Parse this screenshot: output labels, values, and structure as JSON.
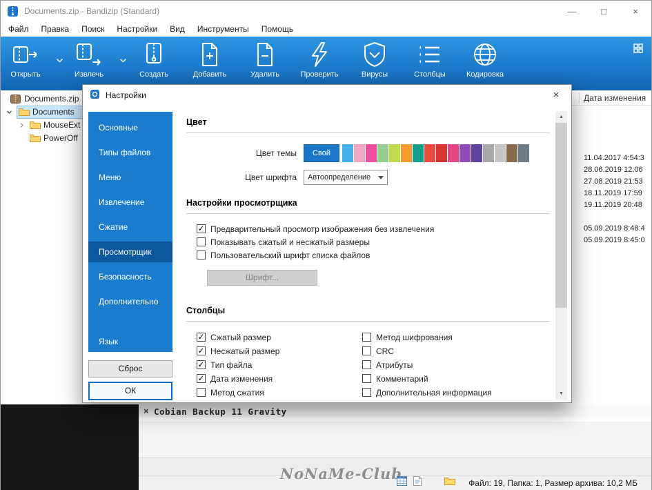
{
  "window": {
    "title": "Documents.zip - Bandizip (Standard)",
    "minimize": "—",
    "maximize": "□",
    "close": "×"
  },
  "menubar": {
    "items": [
      "Файл",
      "Правка",
      "Поиск",
      "Настройки",
      "Вид",
      "Инструменты",
      "Помощь"
    ]
  },
  "toolbar": {
    "buttons": [
      {
        "label": "Открыть",
        "icon": "open-archive-icon",
        "dropdown": true
      },
      {
        "label": "Извлечь",
        "icon": "extract-icon",
        "dropdown": true
      },
      {
        "label": "Создать",
        "icon": "new-archive-icon",
        "dropdown": false
      },
      {
        "label": "Добавить",
        "icon": "add-files-icon",
        "dropdown": false
      },
      {
        "label": "Удалить",
        "icon": "delete-files-icon",
        "dropdown": false
      },
      {
        "label": "Проверить",
        "icon": "test-archive-icon",
        "dropdown": false
      },
      {
        "label": "Вирусы",
        "icon": "virus-scan-icon",
        "dropdown": false
      },
      {
        "label": "Столбцы",
        "icon": "columns-icon",
        "dropdown": false
      },
      {
        "label": "Кодировка",
        "icon": "encoding-icon",
        "dropdown": false
      }
    ]
  },
  "tree": {
    "root": {
      "label": "Documents.zip"
    },
    "items": [
      {
        "label": "Documents",
        "selected": true
      },
      {
        "label": "MouseExt",
        "selected": false
      },
      {
        "label": "PowerOff",
        "selected": false
      }
    ]
  },
  "filelist": {
    "columns": {
      "date": "Дата изменения"
    },
    "dates": [
      "11.04.2017 4:54:3",
      "28.06.2019 12:06",
      "27.08.2019 21:53",
      "18.11.2019 17:59",
      "19.11.2019 20:48",
      "05.09.2019 8:48:4",
      "05.09.2019 8:45:0"
    ],
    "bottom_row": {
      "marker": "×",
      "name": "Cobian Backup 11 Gravity"
    }
  },
  "dialog": {
    "title": "Настройки",
    "close": "×",
    "nav": {
      "items": [
        "Основные",
        "Типы файлов",
        "Меню",
        "Извлечение",
        "Сжатие",
        "Просмотрщик",
        "Безопасность",
        "Дополнительно",
        "Язык"
      ],
      "selected": "Просмотрщик"
    },
    "reset_button": "Сброс",
    "ok_button": "ОК",
    "color_section": {
      "title": "Цвет",
      "theme_label": "Цвет темы",
      "custom_swatch": "Свой",
      "swatches": [
        "#47b1e8",
        "#f2a7c4",
        "#ec4f9e",
        "#97cf8e",
        "#c3d94e",
        "#f59b31",
        "#159e8c",
        "#e94b3f",
        "#d53631",
        "#e8447f",
        "#8f4bba",
        "#5f41a0",
        "#a9a9a9",
        "#c6c6c6",
        "#8a6a4c",
        "#6d7b86"
      ],
      "font_label": "Цвет шрифта",
      "font_value": "Автоопределение"
    },
    "viewer_section": {
      "title": "Настройки просмотрщика",
      "options": [
        {
          "label": "Предварительный просмотр изображения без извлечения",
          "checked": true
        },
        {
          "label": "Показывать сжатый и несжатый размеры",
          "checked": false
        },
        {
          "label": "Пользовательский шрифт списка файлов",
          "checked": false
        }
      ],
      "font_button": "Шрифт..."
    },
    "columns_section": {
      "title": "Столбцы",
      "left": [
        {
          "label": "Сжатый размер",
          "checked": true
        },
        {
          "label": "Несжатый размер",
          "checked": true
        },
        {
          "label": "Тип файла",
          "checked": true
        },
        {
          "label": "Дата изменения",
          "checked": true
        },
        {
          "label": "Метод сжатия",
          "checked": false
        }
      ],
      "right": [
        {
          "label": "Метод шифрования",
          "checked": false
        },
        {
          "label": "CRC",
          "checked": false
        },
        {
          "label": "Атрибуты",
          "checked": false
        },
        {
          "label": "Комментарий",
          "checked": false
        },
        {
          "label": "Дополнительная информация",
          "checked": false
        }
      ]
    }
  },
  "statusbar": {
    "watermark": "NoNaMe-Club",
    "info": "Файл: 19, Папка: 1, Размер архива: 10,2 МБ"
  }
}
